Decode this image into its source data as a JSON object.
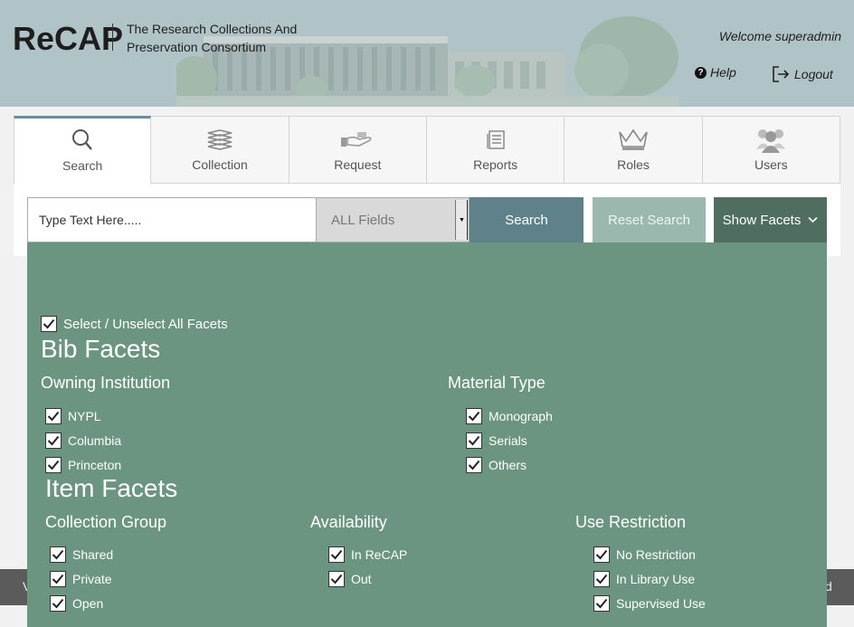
{
  "header": {
    "logo": "ReCAP",
    "tagline": "The Research Collections And Preservation Consortium",
    "welcome": "Welcome superadmin",
    "help_label": "Help",
    "logout_label": "Logout"
  },
  "tabs": [
    {
      "label": "Search",
      "icon": "search-icon",
      "active": true
    },
    {
      "label": "Collection",
      "icon": "books-icon",
      "active": false
    },
    {
      "label": "Request",
      "icon": "hand-book-icon",
      "active": false
    },
    {
      "label": "Reports",
      "icon": "report-icon",
      "active": false
    },
    {
      "label": "Roles",
      "icon": "crown-icon",
      "active": false
    },
    {
      "label": "Users",
      "icon": "users-icon",
      "active": false
    }
  ],
  "search": {
    "placeholder": "Type Text Here.....",
    "field_selected": "ALL Fields",
    "search_label": "Search",
    "reset_label": "Reset Search",
    "facets_label": "Show Facets"
  },
  "footer": {
    "left": "V",
    "right": "d"
  },
  "facets": {
    "select_all_label": "Select / Unselect All Facets",
    "bib_title": "Bib Facets",
    "owning_title": "Owning Institution",
    "owning": [
      "NYPL",
      "Columbia",
      "Princeton"
    ],
    "material_title": "Material Type",
    "material": [
      "Monograph",
      "Serials",
      "Others"
    ],
    "item_title": "Item Facets",
    "collection_title": "Collection Group",
    "collection": [
      "Shared",
      "Private",
      "Open"
    ],
    "availability_title": "Availability",
    "availability": [
      "In ReCAP",
      "Out"
    ],
    "restriction_title": "Use Restriction",
    "restriction": [
      "No Restriction",
      "In Library Use",
      "Supervised Use"
    ]
  },
  "colors": {
    "header_bg": "#b0c4c8",
    "facets_bg": "#6b9580",
    "search_btn": "#5f8189",
    "reset_btn": "#9ab8ad",
    "facets_btn": "#4f6e5f"
  }
}
